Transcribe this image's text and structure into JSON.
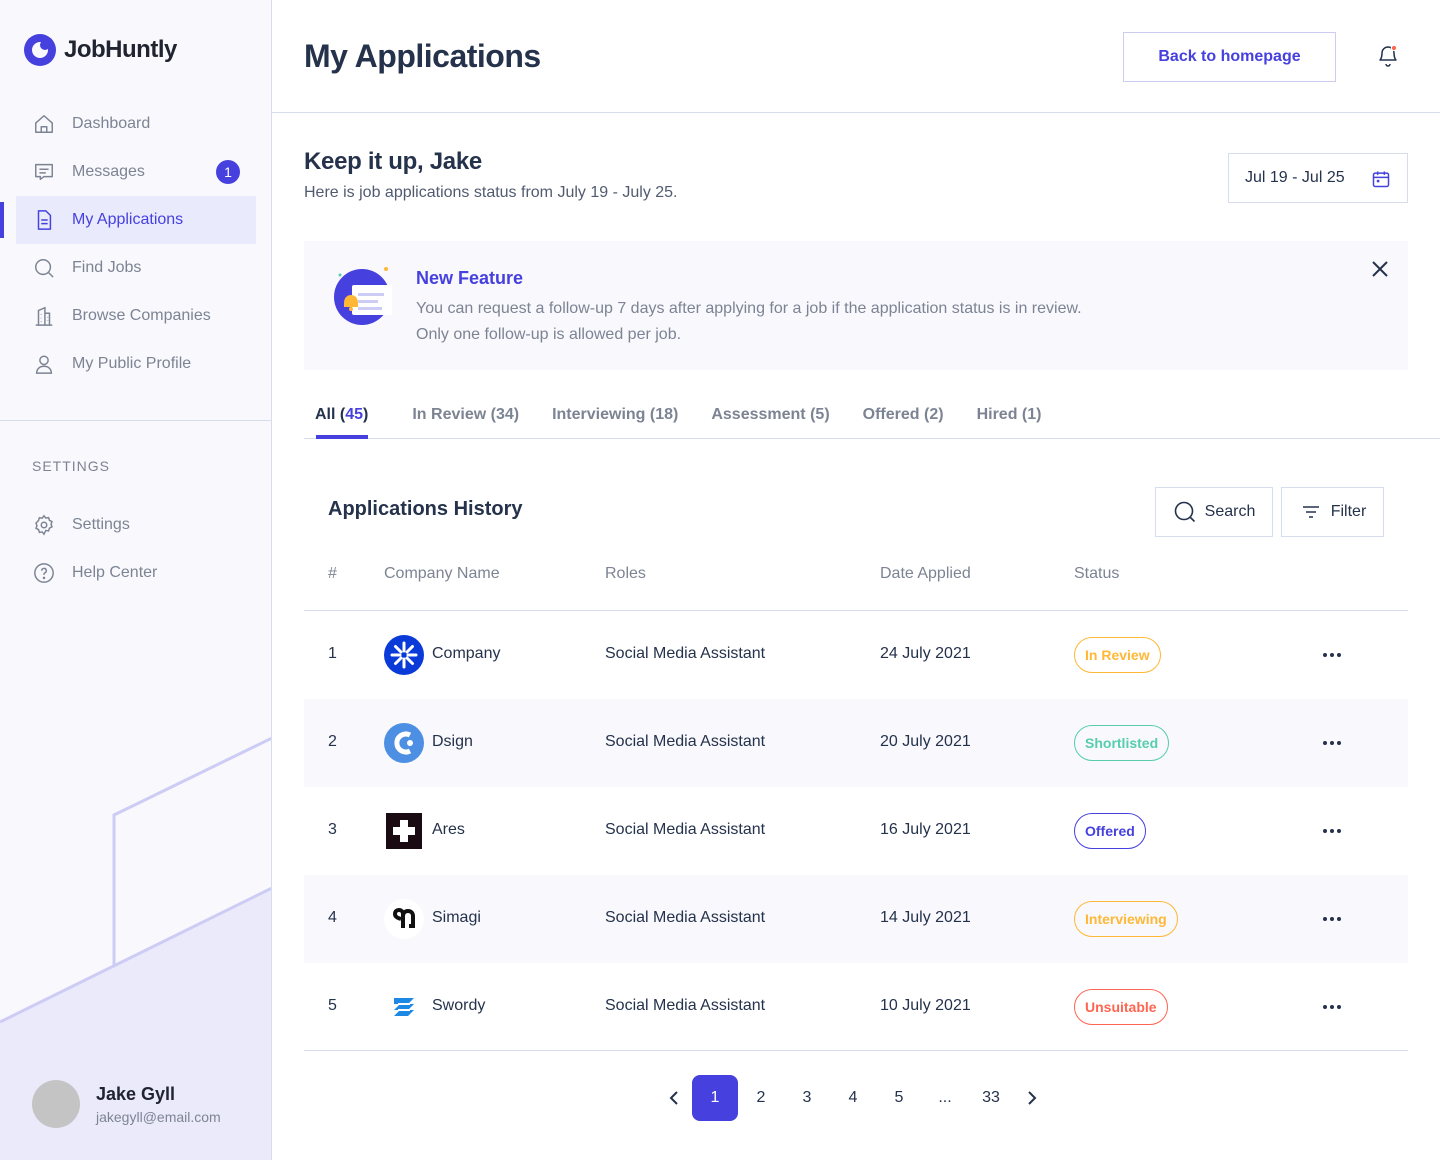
{
  "app": {
    "name": "JobHuntly"
  },
  "sidebar": {
    "items": [
      {
        "label": "Dashboard",
        "icon": "home-icon"
      },
      {
        "label": "Messages",
        "icon": "message-icon",
        "badge": "1"
      },
      {
        "label": "My Applications",
        "icon": "document-icon",
        "active": true
      },
      {
        "label": "Find Jobs",
        "icon": "search-icon"
      },
      {
        "label": "Browse Companies",
        "icon": "building-icon"
      },
      {
        "label": "My Public Profile",
        "icon": "user-icon"
      }
    ],
    "settings_heading": "SETTINGS",
    "settings_items": [
      {
        "label": "Settings",
        "icon": "gear-icon"
      },
      {
        "label": "Help Center",
        "icon": "help-icon"
      }
    ],
    "user": {
      "name": "Jake Gyll",
      "email": "jakegyll@email.com"
    }
  },
  "header": {
    "title": "My Applications",
    "back_button": "Back to homepage"
  },
  "greeting": {
    "title": "Keep it up, Jake",
    "subtitle": "Here is job applications status from July 19 - July 25.",
    "date_range": "Jul 19 - Jul 25"
  },
  "feature": {
    "title": "New Feature",
    "line1": "You can request a follow-up 7 days after applying for a job if the application status is in review.",
    "line2": "Only one follow-up is allowed per job."
  },
  "tabs": [
    {
      "label": "All",
      "count": "45",
      "active": true
    },
    {
      "label": "In Review",
      "count": "34"
    },
    {
      "label": "Interviewing",
      "count": "18"
    },
    {
      "label": "Assessment",
      "count": "5"
    },
    {
      "label": "Offered",
      "count": "2"
    },
    {
      "label": "Hired",
      "count": "1"
    }
  ],
  "history": {
    "title": "Applications History",
    "search_label": "Search",
    "filter_label": "Filter",
    "columns": [
      "#",
      "Company Name",
      "Roles",
      "Date Applied",
      "Status"
    ],
    "rows": [
      {
        "num": "1",
        "company": "Company",
        "role": "Social Media Assistant",
        "date": "24 July 2021",
        "status": "In Review",
        "status_color": "#FFB836"
      },
      {
        "num": "2",
        "company": "Dsign",
        "role": "Social Media Assistant",
        "date": "20 July 2021",
        "status": "Shortlisted",
        "status_color": "#56CDAD"
      },
      {
        "num": "3",
        "company": "Ares",
        "role": "Social Media Assistant",
        "date": "16 July 2021",
        "status": "Offered",
        "status_color": "#4640DE"
      },
      {
        "num": "4",
        "company": "Simagi",
        "role": "Social Media Assistant",
        "date": "14 July 2021",
        "status": "Interviewing",
        "status_color": "#FFB836"
      },
      {
        "num": "5",
        "company": "Swordy",
        "role": "Social Media Assistant",
        "date": "10 July 2021",
        "status": "Unsuitable",
        "status_color": "#FF6550"
      }
    ]
  },
  "pagination": {
    "pages": [
      "1",
      "2",
      "3",
      "4",
      "5",
      "...",
      "33"
    ],
    "current": "1"
  },
  "colors": {
    "accent": "#4640DE",
    "text": "#25324B",
    "muted": "#7C8493",
    "border": "#D6DDEB",
    "panel": "#F8F8FD"
  }
}
